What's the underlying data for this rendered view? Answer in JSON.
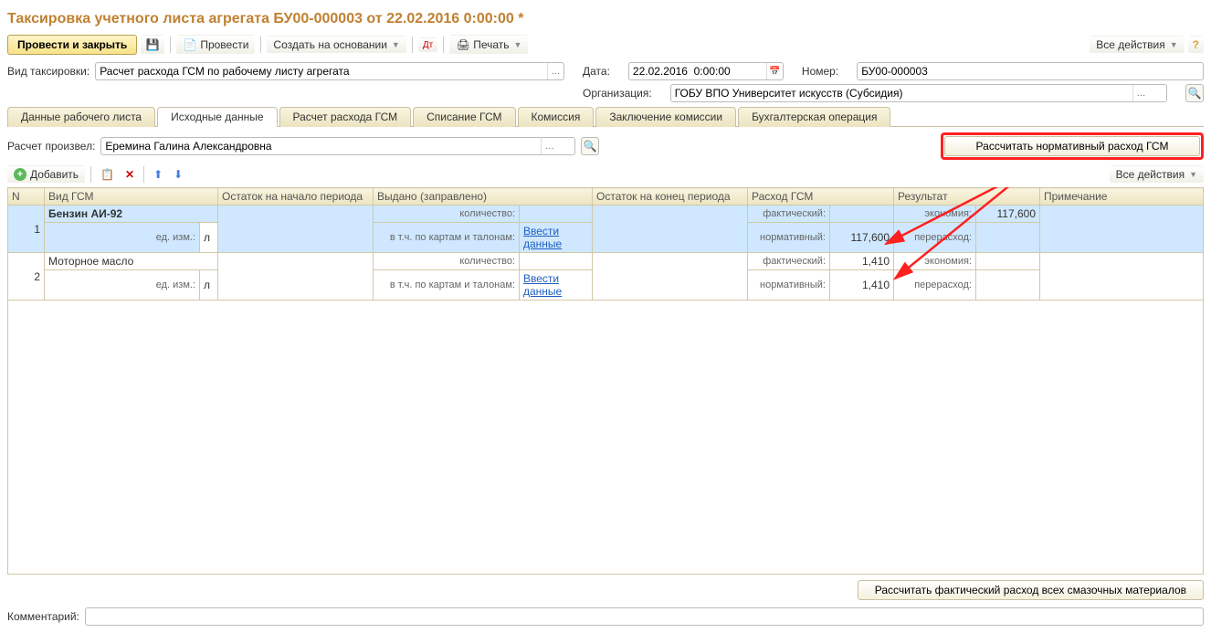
{
  "title": "Таксировка учетного листа агрегата БУ00-000003 от 22.02.2016 0:00:00 *",
  "toolbar": {
    "submit_close": "Провести и закрыть",
    "submit": "Провести",
    "create_based": "Создать на основании",
    "print": "Печать",
    "all_actions": "Все действия"
  },
  "fields": {
    "taxation_type_label": "Вид таксировки:",
    "taxation_type_value": "Расчет расхода ГСМ по рабочему листу агрегата",
    "date_label": "Дата:",
    "date_value": "22.02.2016  0:00:00",
    "number_label": "Номер:",
    "number_value": "БУ00-000003",
    "org_label": "Организация:",
    "org_value": "ГОБУ ВПО Университет искусств (Субсидия)"
  },
  "tabs": [
    "Данные рабочего листа",
    "Исходные данные",
    "Расчет расхода ГСМ",
    "Списание ГСМ",
    "Комиссия",
    "Заключение комиссии",
    "Бухгалтерская операция"
  ],
  "active_tab": 1,
  "calc_row": {
    "label": "Расчет произвел:",
    "value": "Еремина Галина Александровна",
    "button": "Рассчитать нормативный расход ГСМ"
  },
  "subtoolbar": {
    "add": "Добавить",
    "all_actions": "Все действия"
  },
  "grid": {
    "headers": [
      "N",
      "Вид ГСМ",
      "Остаток на начало периода",
      "Выдано (заправлено)",
      "Остаток на конец периода",
      "Расход ГСМ",
      "Результат",
      "Примечание"
    ],
    "sub": {
      "qty": "количество:",
      "cards": "в т.ч. по картам и талонам:",
      "enter_data": "Ввести данные",
      "unit_label": "ед. изм.:",
      "unit": "л",
      "actual": "фактический:",
      "normative": "нормативный:",
      "economy": "экономия:",
      "overrun": "перерасход:"
    },
    "rows": [
      {
        "n": "1",
        "name": "Бензин АИ-92",
        "actual": "",
        "normative": "117,600",
        "economy": "117,600",
        "overrun": ""
      },
      {
        "n": "2",
        "name": "Моторное масло",
        "actual": "1,410",
        "normative": "1,410",
        "economy": "",
        "overrun": ""
      }
    ]
  },
  "bottom_button": "Рассчитать фактический расход всех смазочных материалов",
  "comment_label": "Комментарий:"
}
